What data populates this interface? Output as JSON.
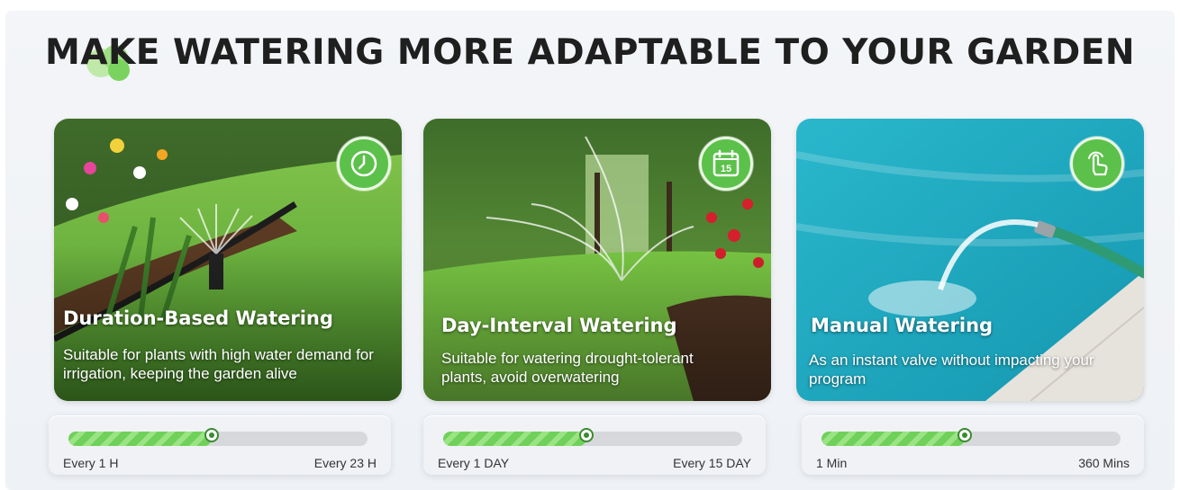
{
  "header": {
    "title": "MAKE WATERING MORE ADAPTABLE TO YOUR GARDEN"
  },
  "colors": {
    "accent_green": "#5cc14a",
    "slider_fill": "#6fd05a",
    "title_text": "#1f1f1f"
  },
  "cards": [
    {
      "title": "Duration-Based Watering",
      "description": "Suitable for plants with high water demand for irrigation, keeping the garden alive",
      "icon": "clock-icon",
      "slider": {
        "min_label": "Every 1 H",
        "max_label": "Every 23 H",
        "level": 0.48
      }
    },
    {
      "title": "Day-Interval Watering",
      "description": "Suitable for watering drought-tolerant plants, avoid overwatering",
      "icon": "calendar-icon",
      "calendar_day": "15",
      "slider": {
        "min_label": "Every 1 DAY",
        "max_label": "Every 15 DAY",
        "level": 0.48
      }
    },
    {
      "title": "Manual Watering",
      "description": "As an instant valve without impacting your program",
      "icon": "hand-tap-icon",
      "slider": {
        "min_label": "1 Min",
        "max_label": "360 Mins",
        "level": 0.48
      }
    }
  ]
}
